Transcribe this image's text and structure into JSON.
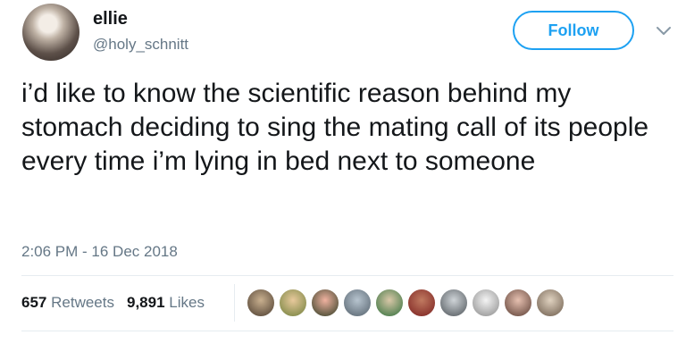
{
  "user": {
    "display_name": "ellie",
    "handle": "@holy_schnitt"
  },
  "follow_button_label": "Follow",
  "tweet": {
    "text": "i’d like to know the scientific reason behind my stomach deciding to sing the mating call of its people every time i’m lying in bed next to someone",
    "timestamp": "2:06 PM - 16 Dec 2018"
  },
  "stats": {
    "retweets_count": "657",
    "retweets_label": "Retweets",
    "likes_count": "9,891",
    "likes_label": "Likes"
  },
  "icons": {
    "more": "chevron-down-icon"
  },
  "colors": {
    "accent": "#1da1f2",
    "secondary_text": "#657786",
    "primary_text": "#14171a",
    "divider": "#e6ecf0"
  },
  "liker_avatar_count": 10
}
